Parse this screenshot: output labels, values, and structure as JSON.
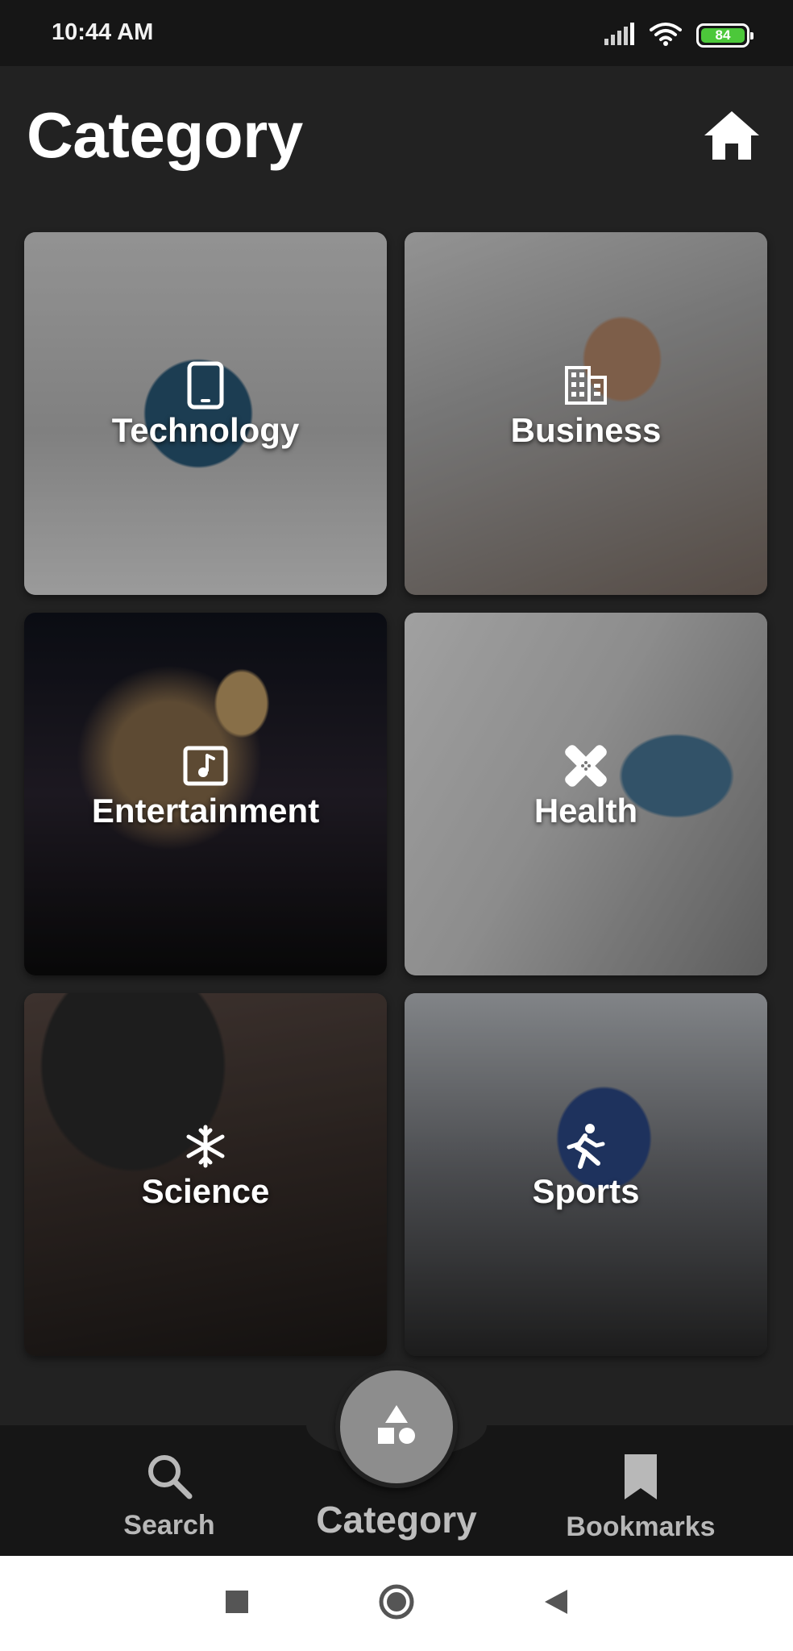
{
  "status_bar": {
    "time": "10:44 AM",
    "battery": "84",
    "icons": [
      "signal-icon",
      "wifi-icon",
      "battery-icon"
    ]
  },
  "header": {
    "title": "Category",
    "home_icon": "home-icon"
  },
  "categories": [
    {
      "label": "Technology",
      "icon": "tablet-icon"
    },
    {
      "label": "Business",
      "icon": "building-icon"
    },
    {
      "label": "Entertainment",
      "icon": "music-note-icon"
    },
    {
      "label": "Health",
      "icon": "bandage-icon"
    },
    {
      "label": "Science",
      "icon": "snowflake-icon"
    },
    {
      "label": "Sports",
      "icon": "running-icon"
    }
  ],
  "bottom_nav": {
    "search_label": "Search",
    "category_label": "Category",
    "bookmarks_label": "Bookmarks",
    "active": "Category"
  },
  "colors": {
    "background": "#222222",
    "bar": "#161616",
    "battery": "#4cc83a",
    "fab": "#8d8d8d",
    "nav_text": "#b8b8b8"
  }
}
